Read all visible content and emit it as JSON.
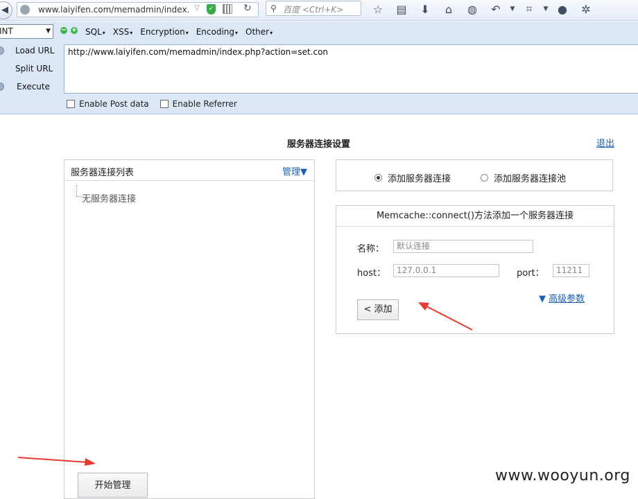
{
  "browser": {
    "url_short": "www.laiyifen.com/memadmin/index.p",
    "search_placeholder": "百度 <Ctrl+K>",
    "toolbar_icons": [
      "star-icon",
      "reading-list-icon",
      "download-icon",
      "home-icon",
      "globe-icon",
      "undo-icon",
      "crop-icon",
      "chat-icon",
      "bug-icon"
    ]
  },
  "hackbar": {
    "select_value": "INT",
    "menus": [
      "SQL",
      "XSS",
      "Encryption",
      "Encoding",
      "Other"
    ],
    "actions": [
      "Load URL",
      "Split URL",
      "Execute"
    ],
    "url_value": "http://www.laiyifen.com/memadmin/index.php?action=set.con",
    "checkboxes": [
      "Enable Post data",
      "Enable Referrer"
    ]
  },
  "page": {
    "title": "服务器连接设置",
    "logout": "退出",
    "left_panel": {
      "title": "服务器连接列表",
      "manage": "管理▼",
      "empty_item": "无服务器连接",
      "start_button": "开始管理"
    },
    "radios": {
      "option1": "添加服务器连接",
      "option2": "添加服务器连接池",
      "selected": "option1"
    },
    "form": {
      "header": "Memcache::connect()方法添加一个服务器连接",
      "name_label": "名称：",
      "name_value": "默认连接",
      "host_label": "host：",
      "host_value": "127.0.0.1",
      "port_label": "port：",
      "port_value": "11211",
      "advanced_arrow": "▼",
      "advanced": "高级参数",
      "add_button": "< 添加"
    }
  },
  "watermark": "www.wooyun.org",
  "colors": {
    "annotation_arrow": "#e8392f",
    "link": "#1a5fb4",
    "hackbar_bg": "#dbe7f5"
  }
}
